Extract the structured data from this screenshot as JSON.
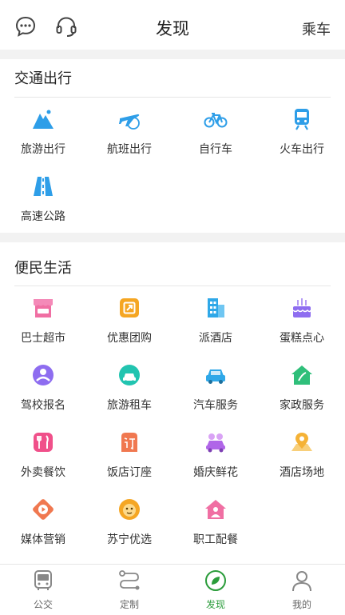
{
  "header": {
    "title": "发现",
    "ride_label": "乘车",
    "left_icons": [
      "chat-bubble-icon",
      "headset-icon"
    ]
  },
  "sections": [
    {
      "title": "交通出行",
      "items": [
        {
          "label": "旅游出行",
          "icon": "mountain-icon",
          "color": "#2e9ee8"
        },
        {
          "label": "航班出行",
          "icon": "airplane-icon",
          "color": "#2e9ee8"
        },
        {
          "label": "自行车",
          "icon": "bicycle-icon",
          "color": "#2e9ee8"
        },
        {
          "label": "火车出行",
          "icon": "train-icon",
          "color": "#2e9ee8"
        },
        {
          "label": "高速公路",
          "icon": "highway-icon",
          "color": "#2e9ee8"
        }
      ]
    },
    {
      "title": "便民生活",
      "items": [
        {
          "label": "巴士超市",
          "icon": "shop-icon",
          "color": "#f06fa3"
        },
        {
          "label": "优惠团购",
          "icon": "coupon-icon",
          "color": "#f5a623"
        },
        {
          "label": "派酒店",
          "icon": "hotel-building-icon",
          "color": "#2fa8e8"
        },
        {
          "label": "蛋糕点心",
          "icon": "cake-icon",
          "color": "#8e6df0"
        },
        {
          "label": "驾校报名",
          "icon": "driver-icon",
          "color": "#8e6df0"
        },
        {
          "label": "旅游租车",
          "icon": "rental-car-icon",
          "color": "#22c4b0"
        },
        {
          "label": "汽车服务",
          "icon": "car-icon",
          "color": "#2fa8e8"
        },
        {
          "label": "家政服务",
          "icon": "house-icon",
          "color": "#2fbf7a"
        },
        {
          "label": "外卖餐饮",
          "icon": "fork-knife-icon",
          "color": "#f0508a"
        },
        {
          "label": "饭店订座",
          "icon": "reserve-icon",
          "color": "#f07850"
        },
        {
          "label": "婚庆鲜花",
          "icon": "wedding-car-icon",
          "color": "#b066e8"
        },
        {
          "label": "酒店场地",
          "icon": "location-pin-icon",
          "color": "#f5b236"
        },
        {
          "label": "媒体营销",
          "icon": "media-play-icon",
          "color": "#f07850"
        },
        {
          "label": "苏宁优选",
          "icon": "lion-icon",
          "color": "#f5a623"
        },
        {
          "label": "职工配餐",
          "icon": "home-meal-icon",
          "color": "#f06fa3"
        }
      ]
    }
  ],
  "tabbar": {
    "active": "发现",
    "accent_color": "#2a9c3a",
    "tabs": [
      {
        "label": "公交",
        "icon": "bus-icon"
      },
      {
        "label": "定制",
        "icon": "route-icon"
      },
      {
        "label": "发现",
        "icon": "compass-leaf-icon"
      },
      {
        "label": "我的",
        "icon": "person-icon"
      }
    ]
  }
}
